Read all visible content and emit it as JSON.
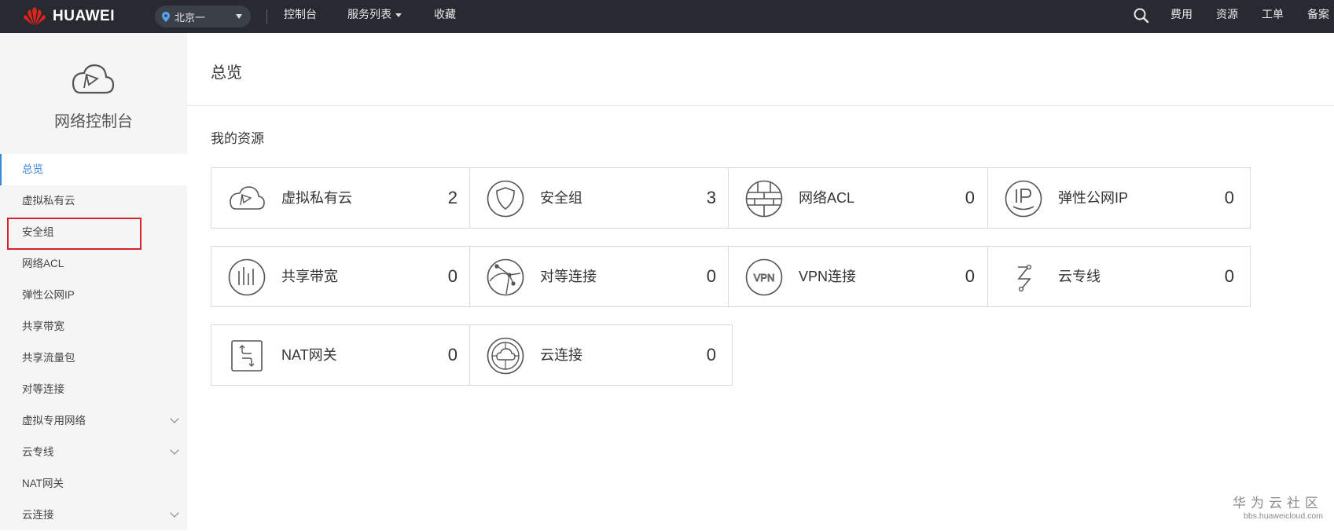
{
  "header": {
    "brand": "HUAWEI",
    "region": "北京一",
    "nav": [
      "控制台",
      "服务列表",
      "收藏"
    ],
    "right": [
      "费用",
      "资源",
      "工单",
      "备案"
    ]
  },
  "sidebar": {
    "title": "网络控制台",
    "items": [
      {
        "label": "总览"
      },
      {
        "label": "虚拟私有云"
      },
      {
        "label": "安全组"
      },
      {
        "label": "网络ACL"
      },
      {
        "label": "弹性公网IP"
      },
      {
        "label": "共享带宽"
      },
      {
        "label": "共享流量包"
      },
      {
        "label": "对等连接"
      },
      {
        "label": "虚拟专用网络"
      },
      {
        "label": "云专线"
      },
      {
        "label": "NAT网关"
      },
      {
        "label": "云连接"
      }
    ]
  },
  "main": {
    "title": "总览",
    "section_title": "我的资源",
    "resources": [
      {
        "label": "虚拟私有云",
        "count": "2",
        "icon": "cloud-icon"
      },
      {
        "label": "安全组",
        "count": "3",
        "icon": "shield-icon"
      },
      {
        "label": "网络ACL",
        "count": "0",
        "icon": "firewall-icon"
      },
      {
        "label": "弹性公网IP",
        "count": "0",
        "icon": "ip-icon"
      },
      {
        "label": "共享带宽",
        "count": "0",
        "icon": "bandwidth-icon"
      },
      {
        "label": "对等连接",
        "count": "0",
        "icon": "peering-icon"
      },
      {
        "label": "VPN连接",
        "count": "0",
        "icon": "vpn-icon"
      },
      {
        "label": "云专线",
        "count": "0",
        "icon": "direct-connect-icon"
      },
      {
        "label": "NAT网关",
        "count": "0",
        "icon": "nat-gateway-icon"
      },
      {
        "label": "云连接",
        "count": "0",
        "icon": "cloud-connect-icon"
      }
    ]
  },
  "watermark": {
    "line1": "华为云社区",
    "line2": "bbs.huaweicloud.com"
  },
  "colors": {
    "topbar": "#272a31",
    "accent": "#3a86d9",
    "highlight": "#d4232b",
    "brand_red": "#e2231a"
  }
}
